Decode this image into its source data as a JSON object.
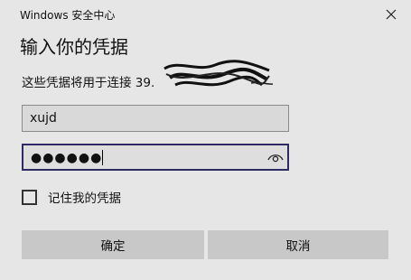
{
  "window": {
    "title": "Windows 安全中心"
  },
  "dialog": {
    "heading": "输入你的凭据",
    "description": "这些凭据将用于连接 39."
  },
  "form": {
    "username": {
      "value": "xujd"
    },
    "password": {
      "masked_value": "●●●●●●",
      "reveal_icon": "eye-icon"
    },
    "remember": {
      "label": "记住我的凭据",
      "checked": false
    }
  },
  "buttons": {
    "ok_label": "确定",
    "cancel_label": "取消"
  },
  "colors": {
    "background": "#e6e6e6",
    "button": "#c8c8c8",
    "focus_border": "#2e2b63"
  }
}
